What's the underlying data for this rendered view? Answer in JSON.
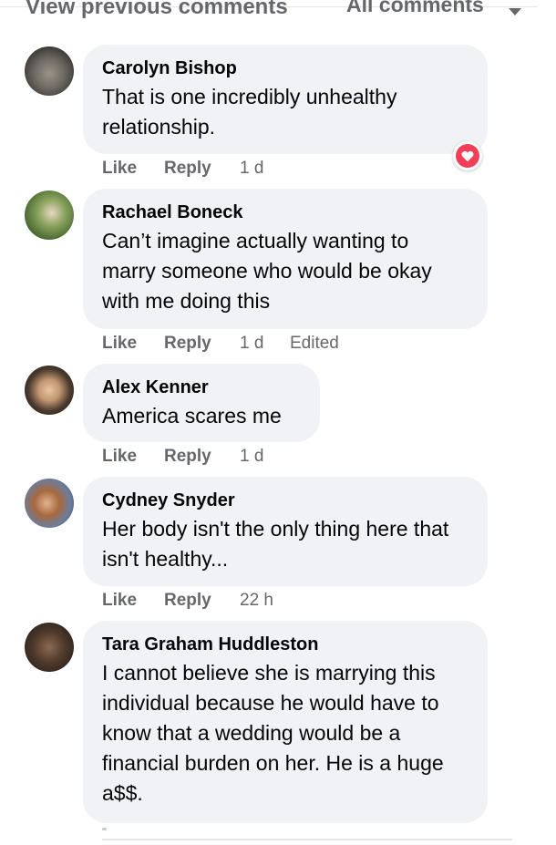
{
  "header": {
    "view_previous_label": "View previous comments",
    "filter_label": "All comments"
  },
  "comments": [
    {
      "author": "Carolyn Bishop",
      "text": "That is one incredibly unhealthy relationship.",
      "like_label": "Like",
      "reply_label": "Reply",
      "time": "1 d",
      "edited": "",
      "reaction": "heart-icon"
    },
    {
      "author": "Rachael Boneck",
      "text": "Can’t imagine actually wanting to marry someone who would be okay with me doing this",
      "like_label": "Like",
      "reply_label": "Reply",
      "time": "1 d",
      "edited": "Edited"
    },
    {
      "author": "Alex Kenner",
      "text": "America scares me",
      "like_label": "Like",
      "reply_label": "Reply",
      "time": "1 d",
      "edited": ""
    },
    {
      "author": "Cydney Snyder",
      "text": "Her body isn't the only thing here that isn't healthy...",
      "like_label": "Like",
      "reply_label": "Reply",
      "time": "22 h",
      "edited": ""
    },
    {
      "author": "Tara Graham Huddleston",
      "text": "I cannot believe she is marrying this individual because he would have to know that a wedding would be a financial burden on her. He is a huge a$$.",
      "like_label": "",
      "reply_label": "",
      "time": "",
      "edited": ""
    }
  ],
  "colors": {
    "bubble": "#f0f2f5",
    "meta_text": "#65676b",
    "heart": "#f33e58"
  }
}
